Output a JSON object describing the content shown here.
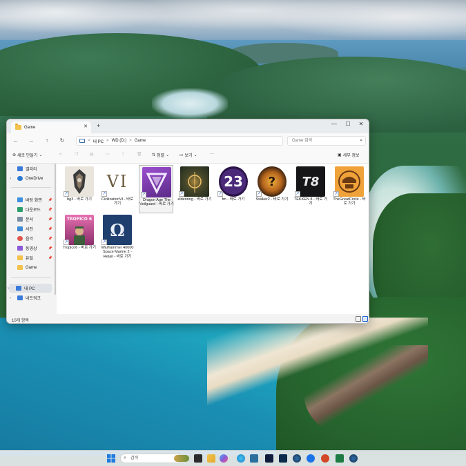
{
  "window": {
    "tab_title": "Game",
    "tab_close": "✕",
    "tab_add": "+",
    "controls": {
      "minimize": "—",
      "maximize": "☐",
      "close": "✕"
    }
  },
  "nav": {
    "back": "←",
    "forward": "→",
    "up": "↑",
    "refresh": "↻",
    "breadcrumbs": [
      "내 PC",
      "WD (D:)",
      "Game"
    ],
    "separator": ">",
    "search_placeholder": "Game 검색",
    "search_icon": "⌕"
  },
  "commands": {
    "new": "새로 만들기",
    "sort": "정렬",
    "view": "보기",
    "more": "···",
    "details": "세부 정보"
  },
  "sidebar": {
    "top": [
      {
        "label": "갤러리",
        "icon": "gallery-icon",
        "color": "#3b7ad8"
      },
      {
        "label": "OneDrive",
        "icon": "cloud-icon",
        "color": "#2a79d3"
      }
    ],
    "quick": [
      {
        "label": "바탕 화면",
        "icon": "desktop-icon",
        "color": "#3d8fe0"
      },
      {
        "label": "다운로드",
        "icon": "download-icon",
        "color": "#2b9f6a"
      },
      {
        "label": "문서",
        "icon": "document-icon",
        "color": "#7a8fa6"
      },
      {
        "label": "사진",
        "icon": "picture-icon",
        "color": "#3c8ad6"
      },
      {
        "label": "음악",
        "icon": "music-icon",
        "color": "#e0564a"
      },
      {
        "label": "동영상",
        "icon": "video-icon",
        "color": "#8a5ad8"
      },
      {
        "label": "유틸",
        "icon": "folder-icon",
        "color": "#f2c24c"
      },
      {
        "label": "Game",
        "icon": "folder-icon",
        "color": "#f2c24c"
      }
    ],
    "bottom": [
      {
        "label": "내 PC",
        "icon": "pc-icon",
        "color": "#3b7ad8"
      },
      {
        "label": "네트워크",
        "icon": "network-icon",
        "color": "#3b7ad8"
      }
    ]
  },
  "files": [
    {
      "label": "bg3 - 바로 가기",
      "thumb_bg": "#e9e4dc",
      "glyph": "☠",
      "glyph_color": "#3b3b3b"
    },
    {
      "label": "CivilizationVI - 바로 가기",
      "thumb_bg": "#ffffff",
      "glyph": "VI",
      "glyph_color": "#6b5b3f"
    },
    {
      "label": "Dragon Age The Veilguard - 바로 가기",
      "thumb_bg": "#7b3ba6",
      "glyph": "▽",
      "glyph_color": "#f1e6ff"
    },
    {
      "label": "eldenring - 바로 가기",
      "thumb_bg": "#2c3a2a",
      "glyph": "◉",
      "glyph_color": "#d8a24a"
    },
    {
      "label": "fm - 바로 가기",
      "thumb_bg": "#3a1f5e",
      "glyph": "23",
      "glyph_color": "#ffffff"
    },
    {
      "label": "Stalker2 - 바로 가기",
      "thumb_bg": "#2b1a0e",
      "glyph": "?",
      "glyph_color": "#f0b03c"
    },
    {
      "label": "TEKKEN 8 - 바로 가기",
      "thumb_bg": "#161618",
      "glyph": "T8",
      "glyph_color": "#e8e8e8"
    },
    {
      "label": "TheGreatCircle - 바로 가기",
      "thumb_bg": "#f0a23a",
      "glyph": "◎",
      "glyph_color": "#6a3a12"
    },
    {
      "label": "Tropico6 - 바로 가기",
      "thumb_bg": "#c74b8f",
      "glyph": "TROPICO 6",
      "glyph_color": "#ffffff"
    },
    {
      "label": "Warhammer 40000 Space Marine 2 - Retail - 바로 가기",
      "thumb_bg": "#1f3f6e",
      "glyph": "Ω",
      "glyph_color": "#e8eef6"
    }
  ],
  "shortcut_arrow": "↗",
  "status": {
    "count": "10개 항목"
  },
  "taskbar": {
    "search_placeholder": "검색",
    "search_icon": "⌕"
  }
}
